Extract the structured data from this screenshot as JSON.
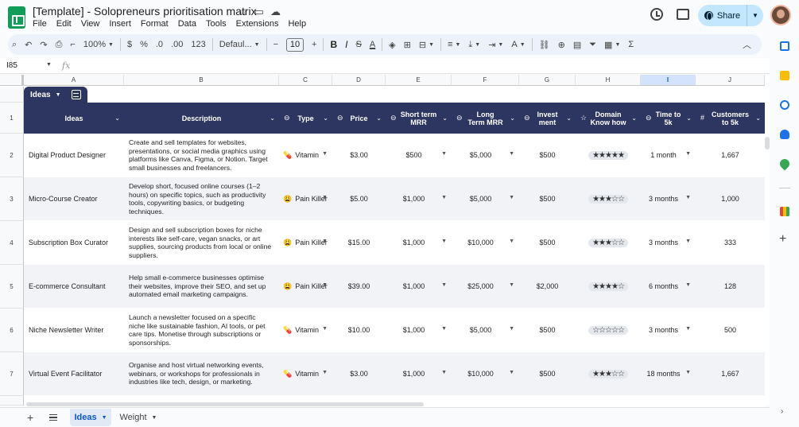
{
  "title": "[Template] - Solopreneurs prioritisation matrix",
  "menu": [
    "File",
    "Edit",
    "View",
    "Insert",
    "Format",
    "Data",
    "Tools",
    "Extensions",
    "Help"
  ],
  "share_label": "Share",
  "toolbar": {
    "zoom": "100%",
    "currency": "$",
    "percent": "%",
    "dec_decrease": ".0",
    "dec_increase": ".00",
    "number_format": "123",
    "font": "Defaul...",
    "font_size": "10",
    "minus": "−",
    "plus": "+",
    "bold": "B",
    "italic": "I",
    "strike": "S",
    "text_color": "A",
    "sigma": "Σ"
  },
  "name_box": "I85",
  "fx": "fx",
  "columns": [
    "A",
    "B",
    "C",
    "D",
    "E",
    "F",
    "G",
    "H",
    "I",
    "J"
  ],
  "selected_column": "I",
  "table_name": "Ideas",
  "headers": [
    {
      "label": "Ideas",
      "icon": ""
    },
    {
      "label": "Description",
      "icon": ""
    },
    {
      "label": "Type",
      "icon": "⊖"
    },
    {
      "label": "Price",
      "icon": "⊖"
    },
    {
      "label": "Short term MRR",
      "icon": "⊖"
    },
    {
      "label": "Long Term MRR",
      "icon": "⊖"
    },
    {
      "label": "Invest ment",
      "icon": "⊖"
    },
    {
      "label": "Domain Know how",
      "icon": "☆"
    },
    {
      "label": "Time to 5k",
      "icon": "⊖"
    },
    {
      "label": "Customers to 5k",
      "icon": "#"
    }
  ],
  "row_numbers": [
    "1",
    "2",
    "3",
    "4",
    "5",
    "6",
    "7"
  ],
  "rows": [
    {
      "idea": "Digital Product Designer",
      "desc": "Create and sell templates for websites, presentations, or social media graphics using platforms like Canva, Figma, or Notion. Target small businesses and freelancers.",
      "type": "Vitamin",
      "type_emoji": "💊",
      "price": "$3.00",
      "short": "$500",
      "long": "$5,000",
      "invest": "$500",
      "stars": "★★★★★",
      "time": "1 month",
      "customers": "1,667"
    },
    {
      "idea": "Micro-Course Creator",
      "desc": "Develop short, focused online courses (1–2 hours) on specific topics, such as productivity tools, copywriting basics, or budgeting techniques.",
      "type": "Pain Killer",
      "type_emoji": "😩",
      "price": "$5.00",
      "short": "$1,000",
      "long": "$5,000",
      "invest": "$500",
      "stars": "★★★☆☆",
      "time": "3 months",
      "customers": "1,000"
    },
    {
      "idea": "Subscription Box Curator",
      "desc": "Design and sell subscription boxes for niche interests like self-care, vegan snacks, or art supplies, sourcing products from local or online suppliers.",
      "type": "Pain Killer",
      "type_emoji": "😩",
      "price": "$15.00",
      "short": "$1,000",
      "long": "$10,000",
      "invest": "$500",
      "stars": "★★★☆☆",
      "time": "3 months",
      "customers": "333"
    },
    {
      "idea": "E-commerce Consultant",
      "desc": "Help small e-commerce businesses optimise their websites, improve their SEO, and set up automated email marketing campaigns.",
      "type": "Pain Killer",
      "type_emoji": "😩",
      "price": "$39.00",
      "short": "$1,000",
      "long": "$25,000",
      "invest": "$2,000",
      "stars": "★★★★☆",
      "time": "6 months",
      "customers": "128"
    },
    {
      "idea": "Niche Newsletter Writer",
      "desc": "Launch a newsletter focused on a specific niche like sustainable fashion, AI tools, or pet care tips. Monetise through subscriptions or sponsorships.",
      "type": "Vitamin",
      "type_emoji": "💊",
      "price": "$10.00",
      "short": "$1,000",
      "long": "$5,000",
      "invest": "$500",
      "stars": "☆☆☆☆☆",
      "time": "3 months",
      "customers": "500"
    },
    {
      "idea": "Virtual Event Facilitator",
      "desc": "Organise and host virtual networking events, webinars, or workshops for professionals in industries like tech, design, or marketing.",
      "type": "Vitamin",
      "type_emoji": "💊",
      "price": "$3.00",
      "short": "$1,000",
      "long": "$10,000",
      "invest": "$500",
      "stars": "★★★☆☆",
      "time": "18 months",
      "customers": "1,667"
    }
  ],
  "sheets": [
    {
      "label": "Ideas",
      "active": true
    },
    {
      "label": "Weight",
      "active": false
    }
  ],
  "colors": {
    "header_bg": "#2d3561",
    "share_bg": "#c2e7ff",
    "selected_col": "#d3e3fd"
  }
}
